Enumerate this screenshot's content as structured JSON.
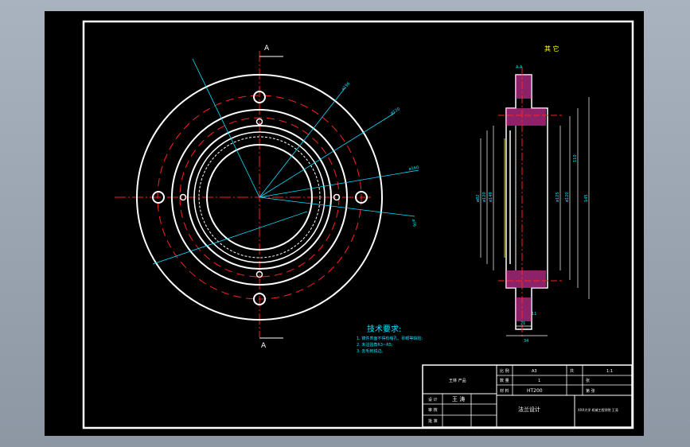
{
  "view": {
    "section_mark_top": "A",
    "section_mark_bottom": "A",
    "side_view_label": "A-A",
    "other_label": "其 它",
    "dims": [
      "ø196",
      "ø120",
      "ø160",
      "ø76",
      "ø82",
      "ø120",
      "ø149",
      "ø125",
      "ø120",
      "110",
      "145",
      "21",
      "34",
      "11"
    ]
  },
  "notes": {
    "title": "技术要求:",
    "items": [
      "1. 铸件表面不得有缩孔、砂眼等缺陷;",
      "2. 未注圆角R3~R5;",
      "3. 去毛刺锐边。"
    ]
  },
  "title_block": {
    "designer_label": "设 计",
    "designer_name": "王 涛",
    "check_label": "审 核",
    "approve_label": "批 准",
    "company": "王林 产品",
    "ratio_label": "比 例",
    "ratio_value": "1:1",
    "sheet_label": "共",
    "sheet_value": "张",
    "number_label": "数 量",
    "number_value": "1",
    "weight_label": "重 量",
    "material_label": "材 料",
    "material_value": "HT200",
    "part_name": "法兰设计",
    "school": "XXX大学 机械工程学院 王涛",
    "col_a": "A3",
    "col_b": "第 张"
  }
}
